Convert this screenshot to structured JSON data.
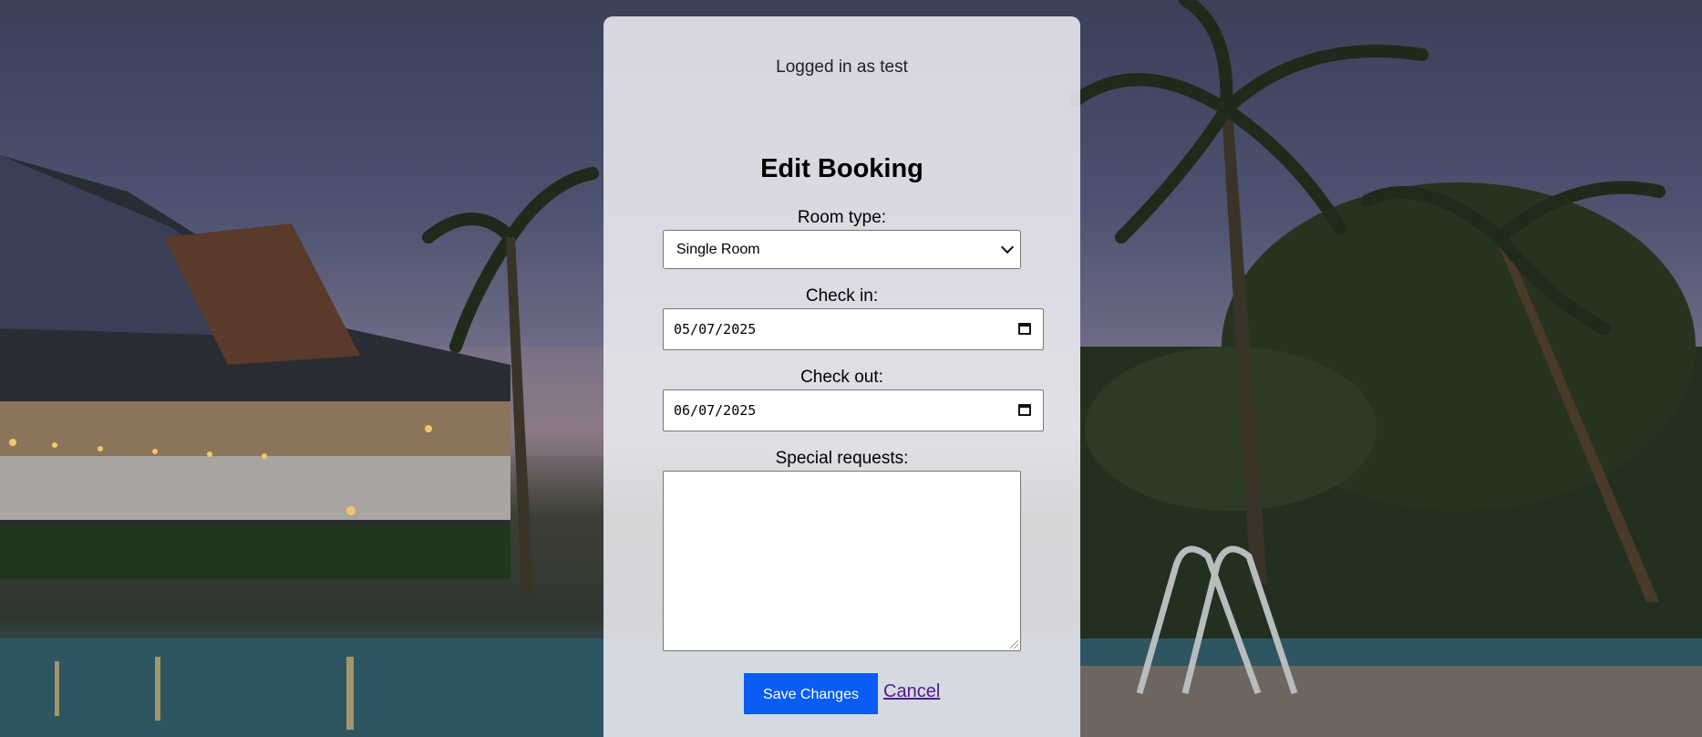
{
  "header": {
    "login_status": "Logged in as test"
  },
  "form": {
    "title": "Edit Booking",
    "room_type": {
      "label": "Room type:",
      "selected": "Single Room"
    },
    "check_in": {
      "label": "Check in:",
      "value": "05/07/2025"
    },
    "check_out": {
      "label": "Check out:",
      "value": "06/07/2025"
    },
    "special_requests": {
      "label": "Special requests:",
      "value": ""
    },
    "save_label": "Save Changes",
    "cancel_label": "Cancel"
  },
  "colors": {
    "primary_button": "#0a5cf5",
    "visited_link": "#551a8b",
    "panel_background": "#f0f0f5"
  },
  "icons": {
    "room_select": "chevron-down-icon",
    "date_picker": "calendar-icon"
  }
}
